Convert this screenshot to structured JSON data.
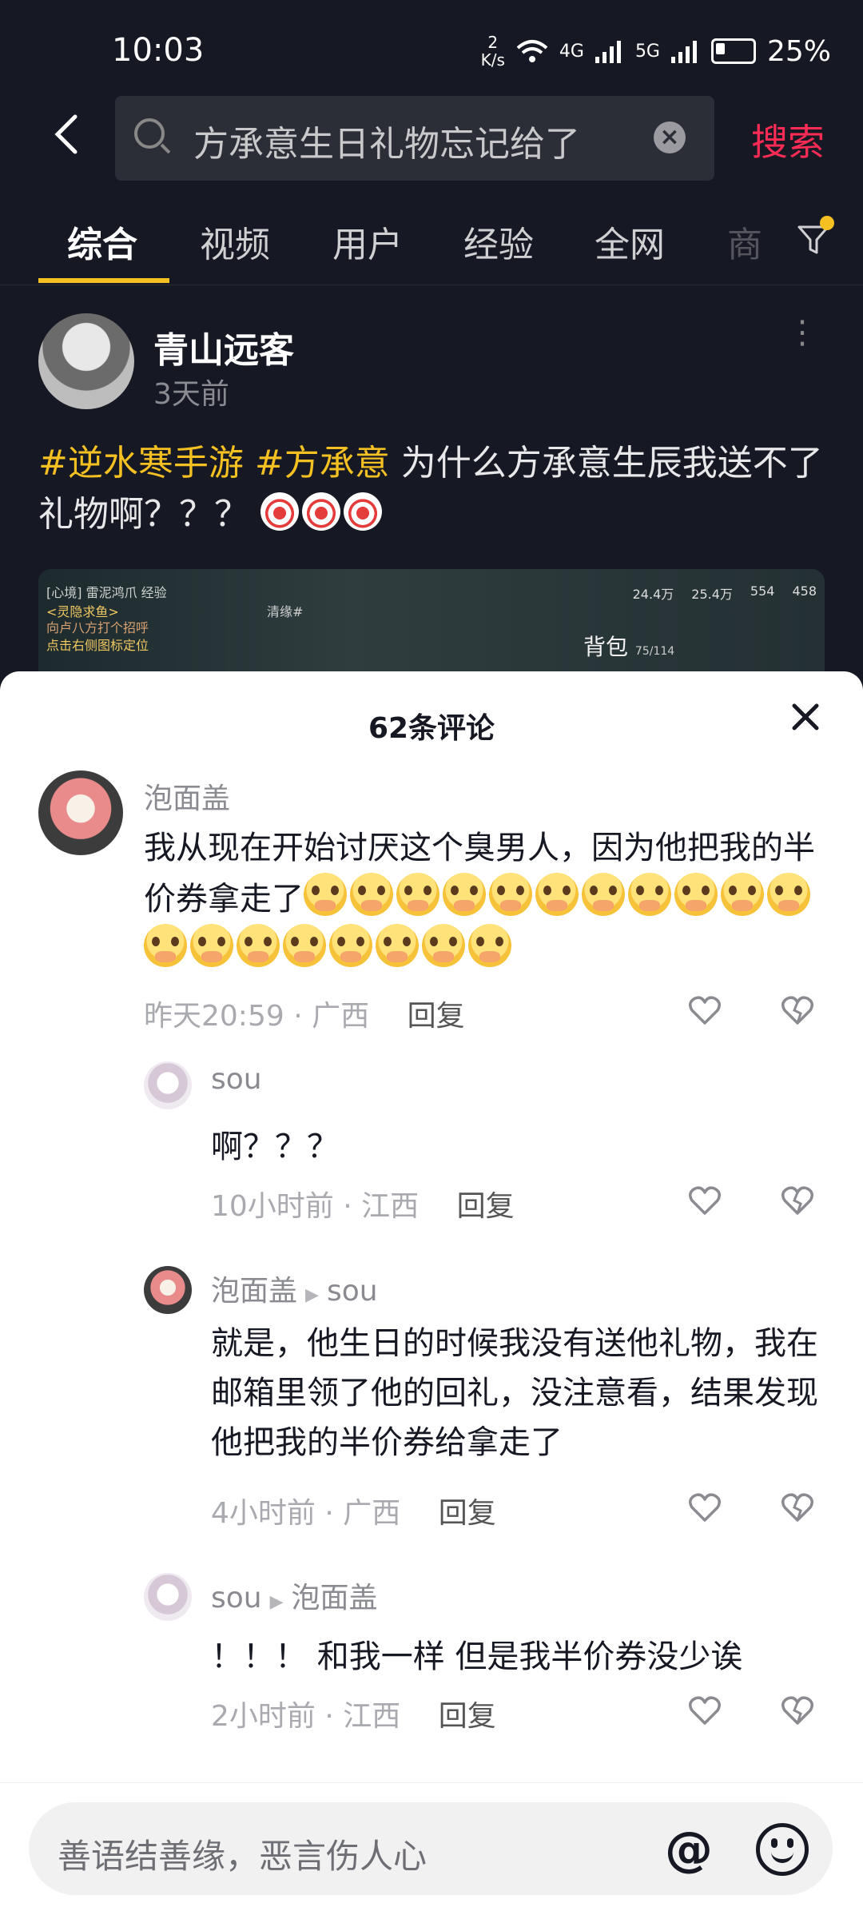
{
  "status_bar": {
    "time": "10:03",
    "net_speed_value": "2",
    "net_speed_unit": "K/s",
    "sig1": "4G",
    "sig2": "5G",
    "battery_text": "25%",
    "battery_level": 0.25
  },
  "search": {
    "query": "方承意生日礼物忘记给了",
    "button_label": "搜索"
  },
  "tabs": [
    "综合",
    "视频",
    "用户",
    "经验",
    "全网",
    "商"
  ],
  "post": {
    "author": "青山远客",
    "time": "3天前",
    "tag1": "#逆水寒手游",
    "tag2": "#方承意",
    "text": " 为什么方承意生辰我送不了礼物啊？？？ ",
    "video": {
      "line1": "[心境] 雷泥鸿爪 经验",
      "line2": "<灵隐求鱼>",
      "line3": "向卢八方打个招呼",
      "line4": "点击右侧图标定位",
      "middle": "清缘#",
      "stat1": "24.4万",
      "stat2": "25.4万",
      "stat3": "554",
      "stat4": "458",
      "bag_label": "背包",
      "bag_count": "75/114"
    }
  },
  "comments_panel": {
    "title": "62条评论",
    "input_placeholder": "善语结善缘，恶言伤人心",
    "comments": [
      {
        "name": "泡面盖",
        "reply_to": "",
        "text": "我从现在开始讨厌这个臭男人，因为他把我的半价券拿走了",
        "emoji_count": 19,
        "time": "昨天20:59",
        "location": "广西",
        "reply_label": "回复"
      },
      {
        "name": "sou",
        "reply_to": "",
        "text": "啊？？？",
        "time": "10小时前",
        "location": "江西",
        "reply_label": "回复"
      },
      {
        "name": "泡面盖",
        "reply_to": "sou",
        "text": "就是，他生日的时候我没有送他礼物，我在邮箱里领了他的回礼，没注意看，结果发现他把我的半价券给拿走了",
        "time": "4小时前",
        "location": "广西",
        "reply_label": "回复"
      },
      {
        "name": "sou",
        "reply_to": "泡面盖",
        "text": "！！！ 和我一样 但是我半价券没少诶",
        "time": "2小时前",
        "location": "江西",
        "reply_label": "回复"
      }
    ]
  }
}
